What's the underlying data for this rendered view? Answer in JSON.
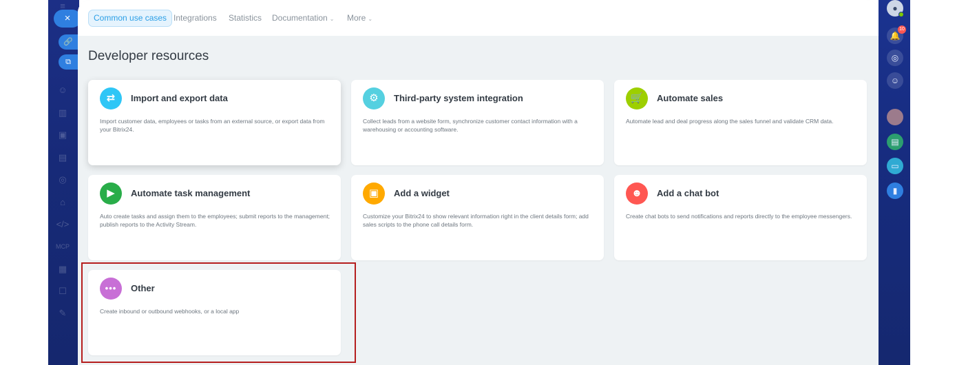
{
  "colors": {
    "rail": "#1c2f86",
    "accent": "#2b9fe6",
    "highlight": "#b51d1d"
  },
  "nav": {
    "tabs": [
      {
        "label": "Common use cases"
      },
      {
        "label": "Integrations"
      },
      {
        "label": "Statistics"
      },
      {
        "label": "Documentation"
      },
      {
        "label": "More"
      }
    ]
  },
  "page": {
    "title": "Developer resources"
  },
  "notifications": {
    "count": "10"
  },
  "cards": [
    {
      "title": "Import and export data",
      "icon": "arrows-swap-icon",
      "color": "#2fc6f6",
      "desc": "Import customer data, employees or tasks from an external source, or export data from your Bitrix24."
    },
    {
      "title": "Third-party system integration",
      "icon": "gears-icon",
      "color": "#55d0e0",
      "desc": "Collect leads from a website form, synchronize customer contact information with a warehousing or accounting software."
    },
    {
      "title": "Automate sales",
      "icon": "cart-icon",
      "color": "#9dcf00",
      "desc": "Automate lead and deal progress along the sales funnel and validate CRM data."
    },
    {
      "title": "Automate task management",
      "icon": "play-icon",
      "color": "#29ad49",
      "desc": "Auto create tasks and assign them to the employees; submit reports to the management; publish reports to the Activity Stream."
    },
    {
      "title": "Add a widget",
      "icon": "widget-icon",
      "color": "#ffa900",
      "desc": "Customize your Bitrix24 to show relevant information right in the client details form; add sales scripts to the phone call details form."
    },
    {
      "title": "Add a chat bot",
      "icon": "robot-icon",
      "color": "#ff5752",
      "desc": "Create chat bots to send notifications and reports directly to the employee messengers."
    },
    {
      "title": "Other",
      "icon": "more-dots-icon",
      "color": "#c86fd6",
      "desc": "Create inbound or outbound webhooks, or a local app"
    }
  ],
  "left_rail": {
    "icons": [
      "menu-icon",
      "link-icon",
      "external-link-icon",
      "contacts-icon",
      "analytics-icon",
      "tasks-icon",
      "sites-icon",
      "store-icon",
      "automation-icon",
      "code-icon",
      "mcp-icon",
      "marketplace-icon",
      "docs-icon",
      "settings-icon"
    ],
    "mcp_label": "MCP"
  }
}
